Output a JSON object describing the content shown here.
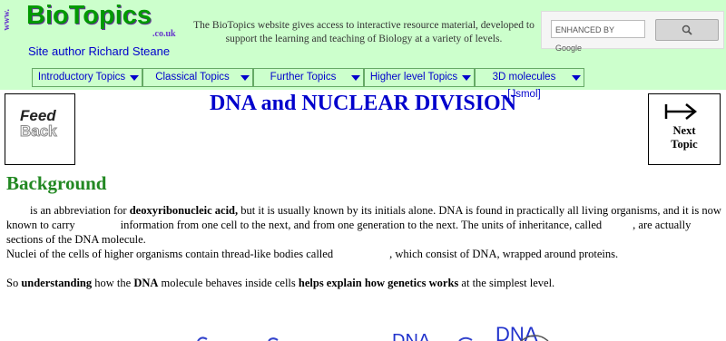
{
  "logo": {
    "www": "www.",
    "name": "BioTopics",
    "domain": ".co.uk"
  },
  "author": "Site author Richard Steane",
  "intro": "The BioTopics website gives access to interactive resource material, developed to support the learning and teaching of Biology at a variety of levels.",
  "search": {
    "placeholder": "ENHANCED BY Google",
    "button_icon": "search-icon"
  },
  "nav": [
    {
      "label": "Introductory Topics"
    },
    {
      "label": "Classical Topics"
    },
    {
      "label": "Further Topics"
    },
    {
      "label": "Higher level Topics"
    },
    {
      "label": "3D molecules [Jsmol]"
    }
  ],
  "feedback": {
    "line1": "Feed",
    "line2": "Back"
  },
  "title": "DNA and NUCLEAR DIVISION",
  "next_topic": {
    "line1": "Next",
    "line2": "Topic"
  },
  "background_heading": "Background",
  "paragraphs": {
    "p1_a": "is an abbreviation for ",
    "p1_b": "deoxyribonucleic acid,",
    "p1_c": " but it is usually known by its initials alone. DNA is found in practically all living organisms, and it is now known to carry",
    "p1_d": "information from one cell to the next, and from one generation to the next. The units of inheritance, called",
    "p1_e": ", are actually sections of the DNA molecule.",
    "p2_a": "Nuclei of the cells of higher organisms contain thread-like bodies called",
    "p2_b": ", which consist of DNA, wrapped around proteins.",
    "p3_a": "So ",
    "p3_b": "understanding",
    "p3_c": " how the ",
    "p3_d": "DNA",
    "p3_e": " molecule behaves inside cells ",
    "p3_f": "helps explain how genetics works",
    "p3_g": " at the simplest level."
  },
  "graphic": {
    "word1": "DNA",
    "word2": "DNA"
  },
  "colors": {
    "header_bg": "#ccffcc",
    "title": "#0000cc",
    "heading": "#228822",
    "logo": "#009900"
  }
}
